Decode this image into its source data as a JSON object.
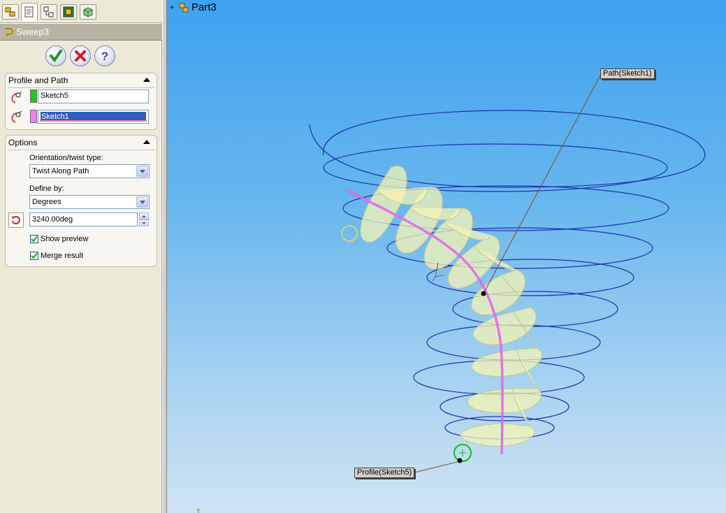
{
  "tabs": [
    {
      "icon": "featuremanager-tree-icon"
    },
    {
      "icon": "propertymanager-icon"
    },
    {
      "icon": "configurationmanager-icon"
    },
    {
      "icon": "dimxpert-manager-icon"
    },
    {
      "icon": "display-manager-icon"
    }
  ],
  "property_manager": {
    "title": "Sweep3",
    "buttons": {
      "ok": "OK",
      "cancel": "Cancel",
      "help": "?"
    },
    "profile_and_path": {
      "header": "Profile and Path",
      "profile_value": "Sketch5",
      "path_value": "Sketch1",
      "profile_color": "#1ec81e",
      "path_color": "#f07ff0"
    },
    "options": {
      "header": "Options",
      "orientation_label": "Orientation/twist type:",
      "orientation_value": "Twist Along Path",
      "define_by_label": "Define by:",
      "define_by_value": "Degrees",
      "angle_value": "3240.00deg",
      "show_preview_label": "Show preview",
      "show_preview_checked": true,
      "merge_result_label": "Merge result",
      "merge_result_checked": true
    }
  },
  "graphics": {
    "tree_root": "Part3",
    "tree_expander": "+",
    "path_callout": "Path(Sketch1)",
    "profile_callout": "Profile(Sketch5)",
    "colors": {
      "helix": "#1c2fb0",
      "path": "#e040e0",
      "preview": "#f4f2b0",
      "profile": "#10c010",
      "leader": "#8a4a1e"
    }
  }
}
